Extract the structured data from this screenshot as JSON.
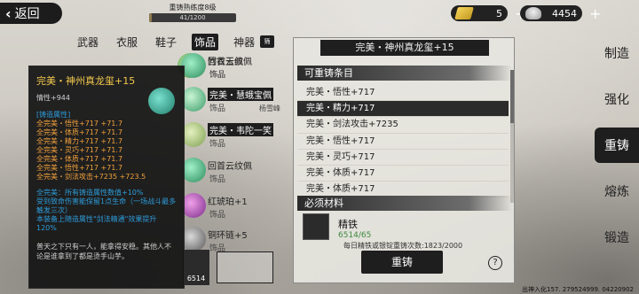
{
  "header": {
    "back_label": "返回",
    "progress_label": "重铸熟练度8级",
    "progress_value": "41/1200",
    "progress_fraction": 0.034,
    "gold": "5",
    "silver": "4454"
  },
  "tabs": [
    "武器",
    "衣服",
    "鞋子",
    "饰品",
    "神器"
  ],
  "active_tab": 3,
  "sort_label": "筛",
  "items": [
    {
      "name": "竹衣玉佩",
      "type": "饰品",
      "owner": ""
    },
    {
      "name": "回首云纹佩",
      "type": "饰品",
      "owner": ""
    },
    {
      "name": "完美・慧蛾宝佩",
      "type": "饰品",
      "owner": "杨雪峰"
    },
    {
      "name": "完美・韦陀一笑",
      "type": "饰品",
      "owner": ""
    },
    {
      "name": "回首云纹佩",
      "type": "饰品",
      "owner": ""
    },
    {
      "name": "红琥珀+1",
      "type": "饰品",
      "owner": ""
    },
    {
      "name": "铜环链+5",
      "type": "饰品",
      "owner": ""
    }
  ],
  "bottom_slot_count": "6514",
  "tooltip": {
    "title": "完美・神州真龙玺+15",
    "base": "情性+944",
    "section": "[铸造属性]",
    "attrs": [
      "全完美・悟性+717 +71.7",
      "全完美・体质+717 +71.7",
      "全完美・精力+717 +71.7",
      "全完美・灵巧+717 +71.7",
      "全完美・体质+717 +71.7",
      "全完美・悟性+717 +71.7",
      "全完美・剑法攻击+7235 +723.5"
    ],
    "blue_lines": [
      "全完美：所有铸造属性数值+10%",
      "受到致命伤害能保留1点生命（一场战斗最多触发三次）",
      "本装备上随造属性\"剑法精通\"效果提升120%"
    ],
    "desc": "普天之下只有一人，能拿得安稳。其他人不论是谁拿到了都是烫手山芋。"
  },
  "panel": {
    "title": "完美・神州真龙玺+15",
    "section_recast": "可重铸条目",
    "options": [
      "完美・悟性+717",
      "完美・精力+717",
      "完美・剑法攻击+7235",
      "完美・悟性+717",
      "完美・灵巧+717",
      "完美・体质+717",
      "完美・体质+717"
    ],
    "selected_option": 1,
    "section_material": "必须材料",
    "material_name": "精铁",
    "material_count": "6514/65",
    "daily_text": "每日精铁或银锭重铸次数:1823/2000",
    "recast_label": "重铸",
    "help_label": "?"
  },
  "side_nav": [
    "制造",
    "强化",
    "重铸",
    "熔炼",
    "锻造"
  ],
  "side_active": 2,
  "footer": "出神入化157. 279524999. 04220902"
}
